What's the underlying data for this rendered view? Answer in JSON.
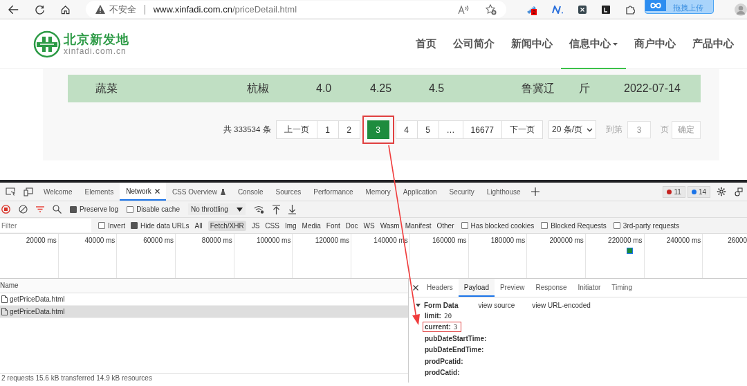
{
  "browser": {
    "security_label": "不安全",
    "url_host": "www.xinfadi.com.cn",
    "url_path": "/priceDetail.html",
    "extension_badge": "2",
    "upload_popup": "拖拽上传"
  },
  "site": {
    "logo_name": "北京新发地",
    "logo_domain": "xinfadi.com.cn",
    "nav": [
      {
        "label": "首页",
        "selected": false,
        "dropdown": false
      },
      {
        "label": "公司简介",
        "selected": false,
        "dropdown": false
      },
      {
        "label": "新闻中心",
        "selected": false,
        "dropdown": false
      },
      {
        "label": "信息中心",
        "selected": true,
        "dropdown": true
      },
      {
        "label": "商户中心",
        "selected": false,
        "dropdown": false
      },
      {
        "label": "产品中心",
        "selected": false,
        "dropdown": false
      }
    ]
  },
  "price_row": [
    "蔬菜",
    "杭椒",
    "4.0",
    "4.25",
    "4.5",
    "鲁冀辽",
    "斤",
    "2022-07-14"
  ],
  "pagination": {
    "total": "共 333534 条",
    "pages": [
      {
        "label": "上一页",
        "selected": false,
        "highlighted": false
      },
      {
        "label": "1",
        "selected": false,
        "highlighted": false
      },
      {
        "label": "2",
        "selected": false,
        "highlighted": false
      },
      {
        "label": "3",
        "selected": true,
        "highlighted": true
      },
      {
        "label": "4",
        "selected": false,
        "highlighted": false
      },
      {
        "label": "5",
        "selected": false,
        "highlighted": false
      },
      {
        "label": "…",
        "selected": false,
        "highlighted": false
      },
      {
        "label": "16677",
        "selected": false,
        "highlighted": false
      },
      {
        "label": "下一页",
        "selected": false,
        "highlighted": false
      }
    ],
    "page_size": "20 条/页",
    "goto_label": "到第",
    "goto_value": "3",
    "goto_unit": "页",
    "confirm": "确定"
  },
  "devtools": {
    "tabs": [
      {
        "label": "Welcome",
        "selected": false
      },
      {
        "label": "Elements",
        "selected": false
      },
      {
        "label": "Network",
        "selected": true
      },
      {
        "label": "CSS Overview",
        "selected": false
      },
      {
        "label": "Console",
        "selected": false
      },
      {
        "label": "Sources",
        "selected": false
      },
      {
        "label": "Performance",
        "selected": false
      },
      {
        "label": "Memory",
        "selected": false
      },
      {
        "label": "Application",
        "selected": false
      },
      {
        "label": "Security",
        "selected": false
      },
      {
        "label": "Lighthouse",
        "selected": false
      }
    ],
    "error_count": "11",
    "message_count": "14",
    "toolbar": {
      "preserve_log": {
        "label": "Preserve log",
        "checked": true
      },
      "disable_cache": {
        "label": "Disable cache",
        "checked": false
      },
      "throttling": "No throttling"
    },
    "filter": {
      "placeholder": "Filter",
      "invert": {
        "label": "Invert",
        "checked": false
      },
      "hide_data_urls": {
        "label": "Hide data URLs",
        "checked": true
      },
      "types": [
        {
          "label": "All",
          "selected": false
        },
        {
          "label": "Fetch/XHR",
          "selected": true
        },
        {
          "label": "JS",
          "selected": false
        },
        {
          "label": "CSS",
          "selected": false
        },
        {
          "label": "Img",
          "selected": false
        },
        {
          "label": "Media",
          "selected": false
        },
        {
          "label": "Font",
          "selected": false
        },
        {
          "label": "Doc",
          "selected": false
        },
        {
          "label": "WS",
          "selected": false
        },
        {
          "label": "Wasm",
          "selected": false
        },
        {
          "label": "Manifest",
          "selected": false
        },
        {
          "label": "Other",
          "selected": false
        }
      ],
      "options": [
        {
          "label": "Has blocked cookies",
          "checked": false
        },
        {
          "label": "Blocked Requests",
          "checked": false
        },
        {
          "label": "3rd-party requests",
          "checked": false
        }
      ]
    },
    "timeline_ticks": [
      "20000 ms",
      "40000 ms",
      "60000 ms",
      "80000 ms",
      "100000 ms",
      "120000 ms",
      "140000 ms",
      "160000 ms",
      "180000 ms",
      "200000 ms",
      "220000 ms",
      "240000 ms",
      "26000"
    ],
    "requests": {
      "header": "Name",
      "rows": [
        {
          "name": "getPriceData.html",
          "selected": false
        },
        {
          "name": "getPriceData.html",
          "selected": true
        }
      ]
    },
    "status": "2 requests  15.6 kB transferred  14.9 kB resources",
    "detail_tabs": [
      {
        "label": "Headers",
        "selected": false
      },
      {
        "label": "Payload",
        "selected": true
      },
      {
        "label": "Preview",
        "selected": false
      },
      {
        "label": "Response",
        "selected": false
      },
      {
        "label": "Initiator",
        "selected": false
      },
      {
        "label": "Timing",
        "selected": false
      }
    ],
    "form_data": {
      "title": "Form Data",
      "links": [
        "view source",
        "view URL-encoded"
      ],
      "fields": [
        {
          "key": "limit:",
          "value": "20",
          "highlighted": false
        },
        {
          "key": "current:",
          "value": "3",
          "highlighted": true
        },
        {
          "key": "pubDateStartTime:",
          "highlighted": false
        },
        {
          "key": "pubDateEndTime:",
          "highlighted": false
        },
        {
          "key": "prodPcatid:",
          "highlighted": false
        },
        {
          "key": "prodCatid:",
          "highlighted": false
        }
      ]
    }
  }
}
